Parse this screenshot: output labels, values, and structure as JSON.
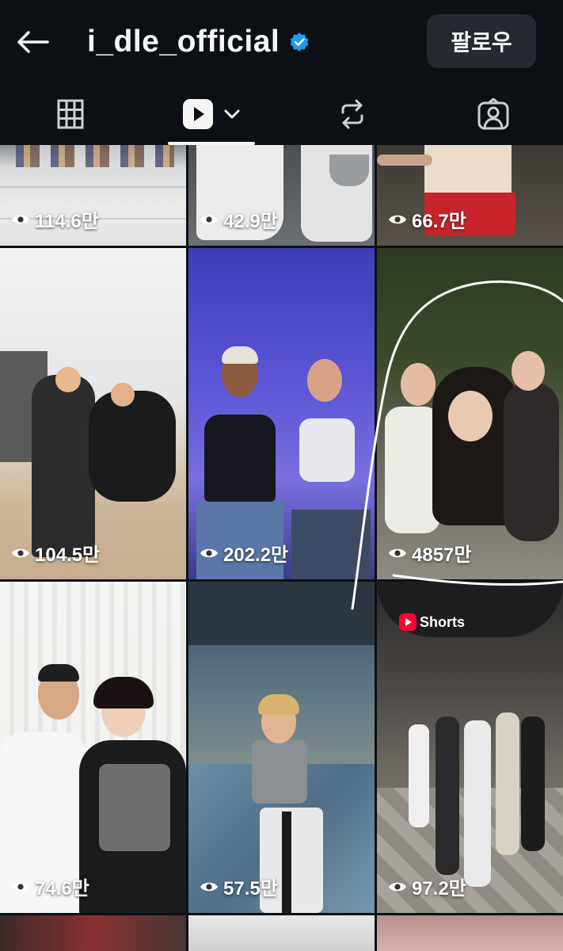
{
  "header": {
    "username": "i_dle_official",
    "follow_label": "팔로우",
    "verified": true,
    "accent_color": "#1d9bf0"
  },
  "tabs": [
    {
      "name": "grid",
      "icon": "grid-icon"
    },
    {
      "name": "reels",
      "icon": "reels-icon",
      "active": true
    },
    {
      "name": "reposts",
      "icon": "repost-icon"
    },
    {
      "name": "tagged",
      "icon": "tagged-icon"
    }
  ],
  "reels": [
    {
      "views": "114.6만"
    },
    {
      "views": "42.9만"
    },
    {
      "views": "66.7만"
    },
    {
      "views": "104.5만"
    },
    {
      "views": "202.2만"
    },
    {
      "views": "4857만"
    },
    {
      "views": "74.6만"
    },
    {
      "views": "57.5만"
    },
    {
      "views": "97.2만",
      "badge": "Shorts"
    }
  ]
}
